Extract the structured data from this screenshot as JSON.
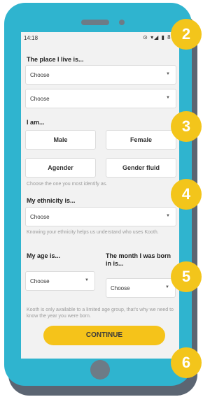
{
  "status_bar": {
    "time": "14:18",
    "icons": "⊙ ▾◢ ▮ 80"
  },
  "place": {
    "label": "The place I live is...",
    "select1": "Choose",
    "select2": "Choose"
  },
  "identity": {
    "label": "I am...",
    "options": [
      "Male",
      "Female",
      "Agender",
      "Gender fluid"
    ],
    "help": "Choose the one you most identify as."
  },
  "ethnicity": {
    "label": "My ethnicity is...",
    "select": "Choose",
    "help": "Knowing your ethnicity helps us understand who uses Kooth."
  },
  "age": {
    "label": "My age is...",
    "select": "Choose"
  },
  "month": {
    "label": "The month I was born in is...",
    "select": "Choose"
  },
  "age_help": "Kooth is only available to a limited age group, that's why we need to know the year you were born.",
  "continue_label": "CONTINUE",
  "badges": [
    "2",
    "3",
    "4",
    "5",
    "6"
  ],
  "colors": {
    "phone": "#2fb4cf",
    "accent": "#f5c31a",
    "badge": "#f3c51b"
  }
}
